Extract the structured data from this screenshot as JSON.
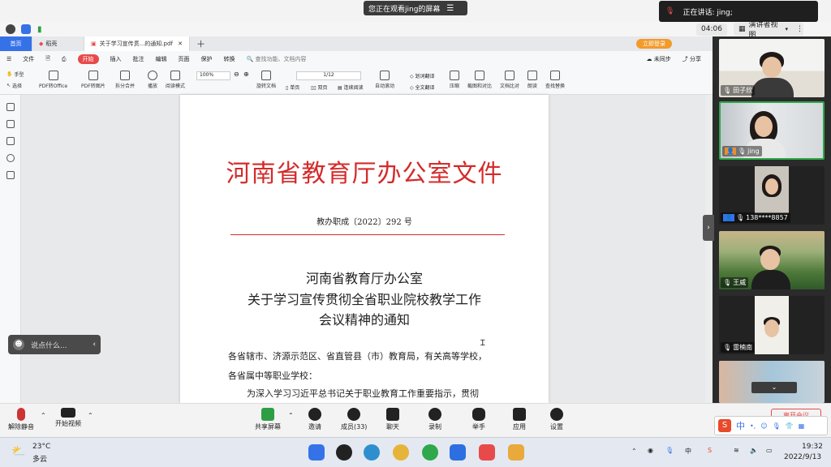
{
  "meeting": {
    "share_banner": "您正在观看jing的屏幕",
    "speaking": "正在讲话: jing;",
    "timer": "04:06",
    "view_mode": "演讲者视图"
  },
  "wps": {
    "tabs": [
      {
        "label": "首页"
      },
      {
        "label": "稻壳"
      },
      {
        "label": "关于学习宣传贯...的通知.pdf"
      }
    ],
    "login_button": "立即登录",
    "menu": [
      "文件",
      "开始",
      "插入",
      "批注",
      "编辑",
      "页面",
      "保护",
      "转换"
    ],
    "search_placeholder": "查找功能、文档内容",
    "sync_label": "未同步",
    "share_label": "分享",
    "ribbon": {
      "hand": "手型",
      "select": "选择",
      "pdf_office": "PDF转Office",
      "pdf_image": "PDF转图片",
      "split_merge": "拆分合并",
      "play": "播放",
      "read_mode": "阅读模式",
      "zoom": "100%",
      "rotate": "旋转文档",
      "single": "单页",
      "double": "双页",
      "continuous": "连续阅读",
      "page": "1/12",
      "auto_scroll": "自动滚动",
      "translate": "划词翻译",
      "full_translate": "全文翻译",
      "compress": "压缩",
      "screenshot": "截图和对比",
      "compare": "文档比对",
      "read_aloud": "朗读",
      "find_replace": "查找替换"
    }
  },
  "document": {
    "header": "河南省教育厅办公室文件",
    "doc_number": "教办职成〔2022〕292 号",
    "title_line1": "河南省教育厅办公室",
    "title_line2": "关于学习宣传贯彻全省职业院校教学工作",
    "title_line3": "会议精神的通知",
    "recipients_line1": "各省辖市、济源示范区、省直管县（市）教育局，有关高等学校，",
    "recipients_line2": "各省属中等职业学校：",
    "body_line1": "为深入学习习近平总书记关于职业教育工作重要指示，贯彻"
  },
  "participants": [
    {
      "name": "田子欣"
    },
    {
      "name": "jing"
    },
    {
      "name": "138****8857"
    },
    {
      "name": "王威"
    },
    {
      "name": "雷楠南"
    }
  ],
  "chat_placeholder": "说点什么...",
  "controls": {
    "unmute": "解除静音",
    "start_video": "开始视频",
    "share_screen": "共享屏幕",
    "invite": "邀请",
    "members": "成员(33)",
    "chat": "聊天",
    "record": "录制",
    "raise_hand": "举手",
    "apps": "应用",
    "settings": "设置",
    "end_meeting": "离开会议"
  },
  "taskbar": {
    "temperature": "23°C",
    "weather": "多云",
    "time": "19:32",
    "date": "2022/9/13",
    "ime": "中"
  },
  "colors": {
    "accent": "#3572e8",
    "doc_red": "#d42b2b",
    "menu_start": "#e84a4a"
  }
}
